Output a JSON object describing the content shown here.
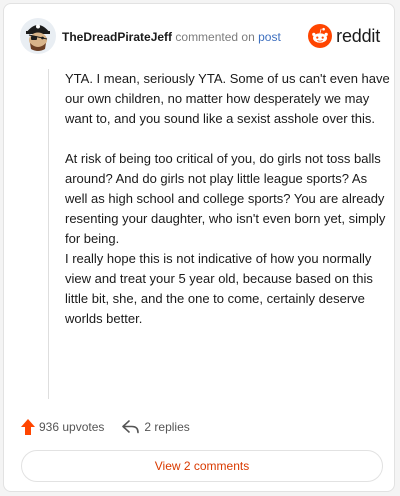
{
  "header": {
    "username": "TheDreadPirateJeff",
    "action_text": "commented on",
    "target_link": "post",
    "brand": "reddit",
    "avatar_icon": "pirate-snoo-icon",
    "logo_icon": "reddit-snoo-icon"
  },
  "comment": {
    "paragraphs": [
      "YTA. I mean, seriously YTA. Some of us can't even have our own children, no matter how desperately we may want to, and you sound like a sexist asshole over this.",
      "At risk of being too critical of you, do girls not toss balls around? And do girls not play little league sports? As well as high school and college sports? You are already resenting your daughter, who isn't even born yet, simply for being.\nI really hope this is not indicative of how you normally view and treat your 5 year old, because based on this little bit, she, and the one to come, certainly deserve worlds better."
    ]
  },
  "actions": {
    "upvotes": "936 upvotes",
    "replies": "2 replies",
    "upvote_icon": "upvote-arrow-icon",
    "reply_icon": "reply-arrow-icon"
  },
  "view_button": {
    "label": "View 2 comments"
  },
  "colors": {
    "accent": "#ff4500",
    "link": "#3d6fbf",
    "button_text": "#d93a00"
  }
}
